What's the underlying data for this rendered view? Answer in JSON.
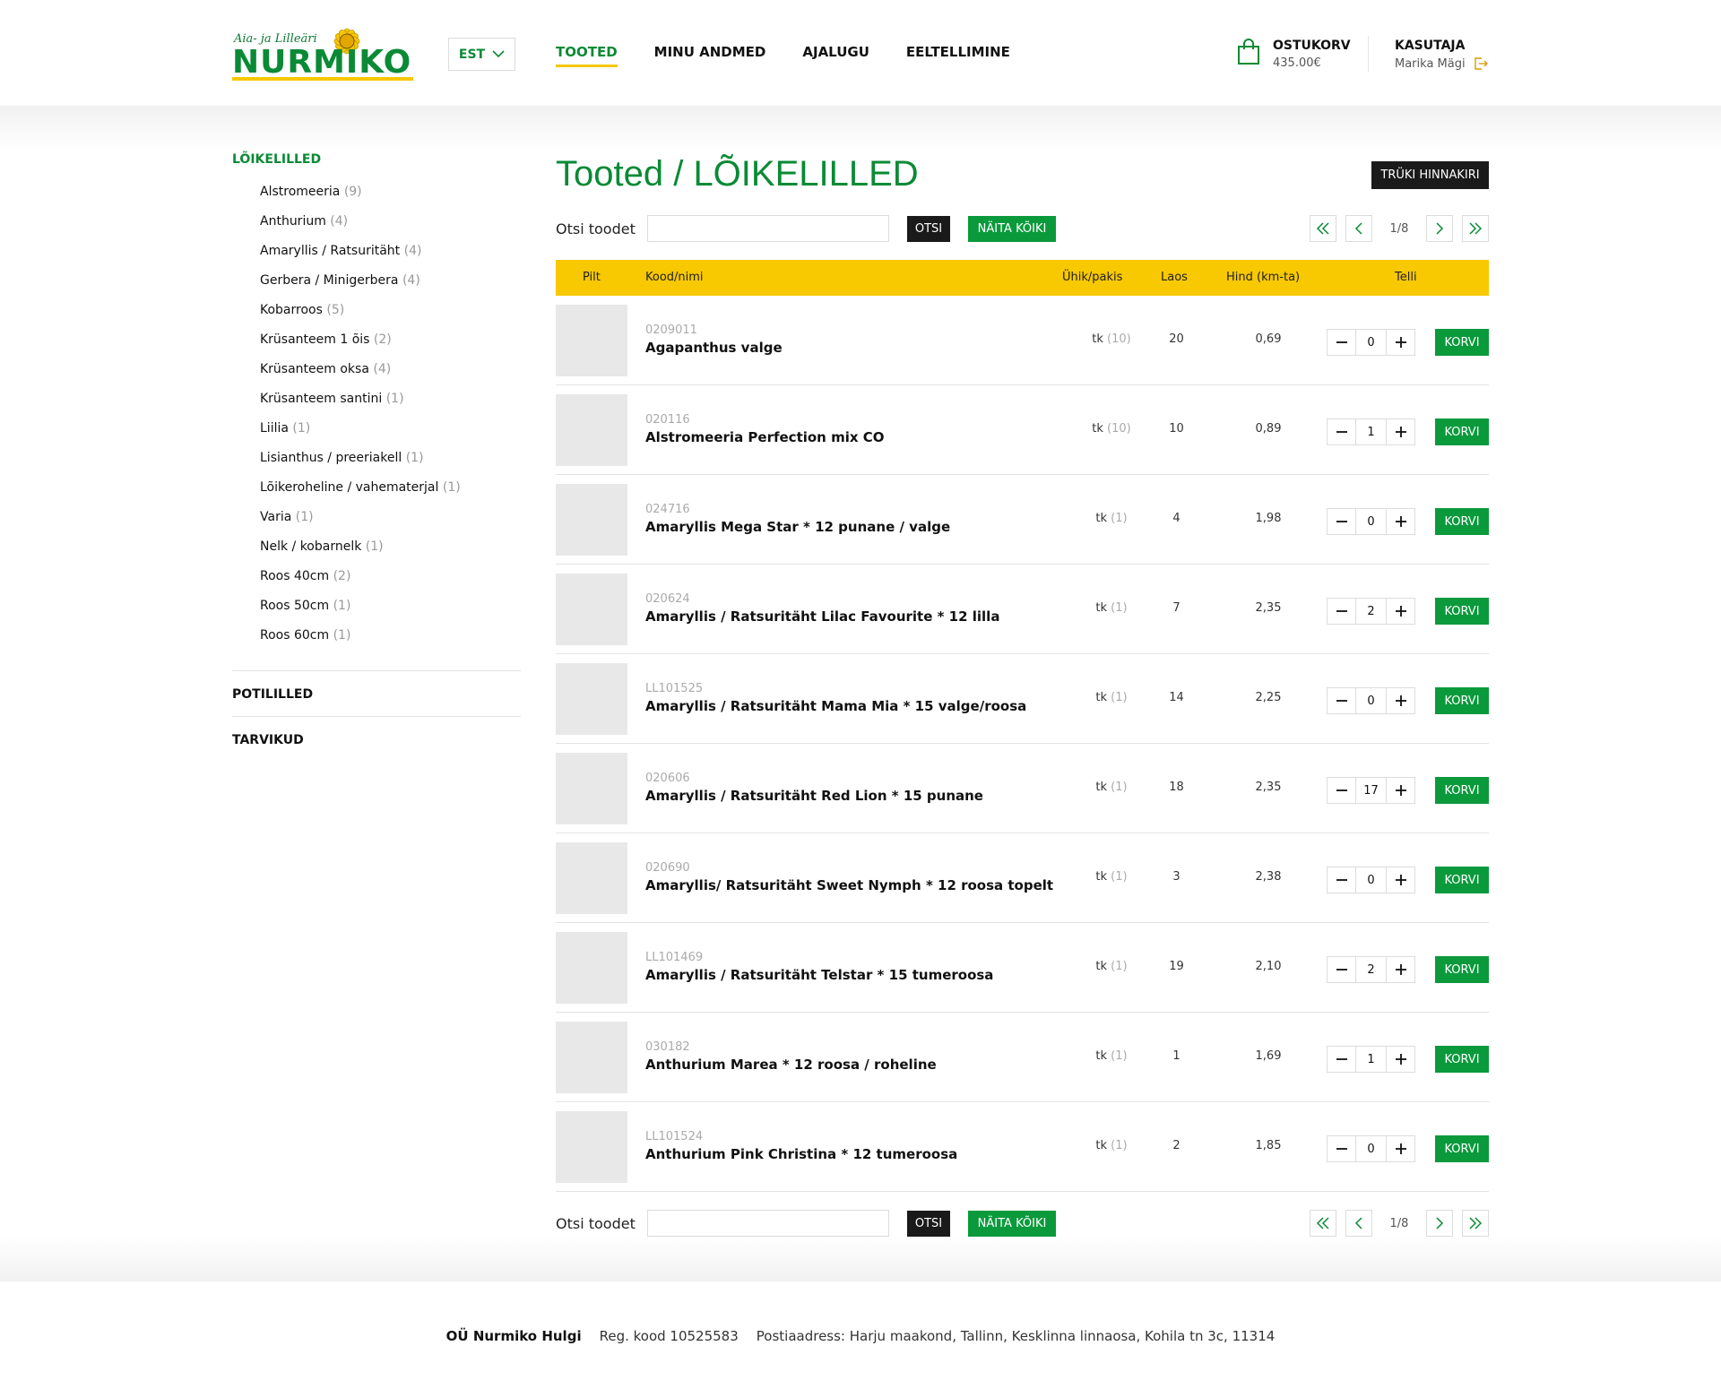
{
  "brand": {
    "logo_script": "Aia- ja Lilleäri",
    "logo_word": "NURMIKO",
    "colors": {
      "green": "#0a8a35",
      "yellow": "#f8c800",
      "dark": "#1a1a1a"
    }
  },
  "header": {
    "language": "EST",
    "nav": [
      {
        "label": "TOOTED",
        "active": true
      },
      {
        "label": "MINU ANDMED",
        "active": false
      },
      {
        "label": "AJALUGU",
        "active": false
      },
      {
        "label": "EELTELLIMINE",
        "active": false
      }
    ],
    "cart": {
      "title": "OSTUKORV",
      "total": "435.00€",
      "icon": "shopping-bag-icon"
    },
    "user": {
      "title": "KASUTAJA",
      "name": "Marika Mägi",
      "logout_icon": "logout-icon"
    }
  },
  "sidebar": {
    "active_category": "LÕIKELILLED",
    "subcategories": [
      {
        "label": "Alstromeeria",
        "count": "(9)"
      },
      {
        "label": "Anthurium",
        "count": "(4)"
      },
      {
        "label": "Amaryllis / Ratsuritäht",
        "count": "(4)"
      },
      {
        "label": "Gerbera / Minigerbera",
        "count": "(4)"
      },
      {
        "label": "Kobarroos",
        "count": "(5)"
      },
      {
        "label": "Krüsanteem 1 õis",
        "count": "(2)"
      },
      {
        "label": "Krüsanteem oksa",
        "count": "(4)"
      },
      {
        "label": "Krüsanteem santini",
        "count": "(1)"
      },
      {
        "label": "Liilia",
        "count": "(1)"
      },
      {
        "label": "Lisianthus / preeriakell",
        "count": "(1)"
      },
      {
        "label": "Lõikeroheline / vahematerjal",
        "count": "(1)"
      },
      {
        "label": "Varia",
        "count": "(1)"
      },
      {
        "label": "Nelk / kobarnelk",
        "count": "(1)"
      },
      {
        "label": "Roos 40cm",
        "count": "(2)"
      },
      {
        "label": "Roos 50cm",
        "count": "(1)"
      },
      {
        "label": "Roos 60cm",
        "count": "(1)"
      }
    ],
    "categories": [
      "POTILILLED",
      "TARVIKUD"
    ]
  },
  "main": {
    "title": "Tooted / LÕIKELILLED",
    "print_label": "TRÜKI HINNAKIRI",
    "search": {
      "label": "Otsi toodet",
      "placeholder": "",
      "value": "",
      "search_button": "OTSI",
      "show_all_button": "NÄITA KÕIKI"
    },
    "pagination": {
      "text": "1/8"
    },
    "columns": {
      "image": "Pilt",
      "code_name": "Kood/nimi",
      "unit": "Ühik/pakis",
      "stock": "Laos",
      "price": "Hind (km-ta)",
      "order": "Telli"
    },
    "add_label": "KORVI",
    "products": [
      {
        "code": "0209011",
        "name": "Agapanthus valge",
        "unit": "tk",
        "pack": "(10)",
        "stock": "20",
        "price": "0,69",
        "qty": "0"
      },
      {
        "code": "020116",
        "name": "Alstromeeria Perfection mix CO",
        "unit": "tk",
        "pack": "(10)",
        "stock": "10",
        "price": "0,89",
        "qty": "1"
      },
      {
        "code": "024716",
        "name": "Amaryllis Mega Star * 12 punane / valge",
        "unit": "tk",
        "pack": "(1)",
        "stock": "4",
        "price": "1,98",
        "qty": "0"
      },
      {
        "code": "020624",
        "name": "Amaryllis / Ratsuritäht Lilac Favourite * 12 lilla",
        "unit": "tk",
        "pack": "(1)",
        "stock": "7",
        "price": "2,35",
        "qty": "2"
      },
      {
        "code": "LL101525",
        "name": "Amaryllis / Ratsuritäht Mama Mia * 15 valge/roosa",
        "unit": "tk",
        "pack": "(1)",
        "stock": "14",
        "price": "2,25",
        "qty": "0"
      },
      {
        "code": "020606",
        "name": "Amaryllis / Ratsuritäht Red Lion * 15 punane",
        "unit": "tk",
        "pack": "(1)",
        "stock": "18",
        "price": "2,35",
        "qty": "17"
      },
      {
        "code": "020690",
        "name": "Amaryllis/ Ratsuritäht Sweet Nymph * 12 roosa topelt",
        "unit": "tk",
        "pack": "(1)",
        "stock": "3",
        "price": "2,38",
        "qty": "0"
      },
      {
        "code": "LL101469",
        "name": "Amaryllis / Ratsuritäht Telstar * 15 tumeroosa",
        "unit": "tk",
        "pack": "(1)",
        "stock": "19",
        "price": "2,10",
        "qty": "2"
      },
      {
        "code": "030182",
        "name": "Anthurium Marea * 12 roosa / roheline",
        "unit": "tk",
        "pack": "(1)",
        "stock": "1",
        "price": "1,69",
        "qty": "1"
      },
      {
        "code": "LL101524",
        "name": "Anthurium Pink Christina * 12 tumeroosa",
        "unit": "tk",
        "pack": "(1)",
        "stock": "2",
        "price": "1,85",
        "qty": "0"
      }
    ]
  },
  "footer": {
    "company": "OÜ Nurmiko Hulgi",
    "reg": "Reg. kood 10525583",
    "address": "Postiaadress: Harju maakond, Tallinn, Kesklinna linnaosa, Kohila tn 3c, 11314"
  }
}
